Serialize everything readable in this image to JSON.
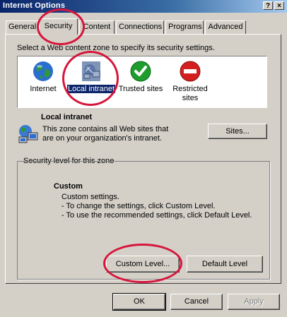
{
  "window": {
    "title": "Internet Options",
    "help_glyph": "?",
    "close_glyph": "×"
  },
  "tabs": [
    {
      "label": "General"
    },
    {
      "label": "Security"
    },
    {
      "label": "Content"
    },
    {
      "label": "Connections"
    },
    {
      "label": "Programs"
    },
    {
      "label": "Advanced"
    }
  ],
  "security": {
    "instruction": "Select a Web content zone to specify its security settings.",
    "zones": [
      {
        "label": "Internet",
        "icon": "globe-icon"
      },
      {
        "label": "Local intranet",
        "icon": "intranet-icon"
      },
      {
        "label": "Trusted sites",
        "icon": "check-icon"
      },
      {
        "label": "Restricted sites",
        "icon": "restricted-icon"
      }
    ],
    "zone_title": "Local intranet",
    "zone_desc_line1": "This zone contains all Web sites that",
    "zone_desc_line2": "are on your organization's intranet.",
    "sites_button": "Sites...",
    "level_group": "Security level for this zone",
    "level_name": "Custom",
    "level_desc": [
      "Custom settings.",
      "- To change the settings, click Custom Level.",
      "- To use the recommended settings, click Default Level."
    ],
    "custom_level_button": "Custom Level...",
    "default_level_button": "Default Level"
  },
  "footer": {
    "ok": "OK",
    "cancel": "Cancel",
    "apply": "Apply"
  },
  "colors": {
    "annotation": "#d6163c",
    "selection": "#0a246a"
  }
}
